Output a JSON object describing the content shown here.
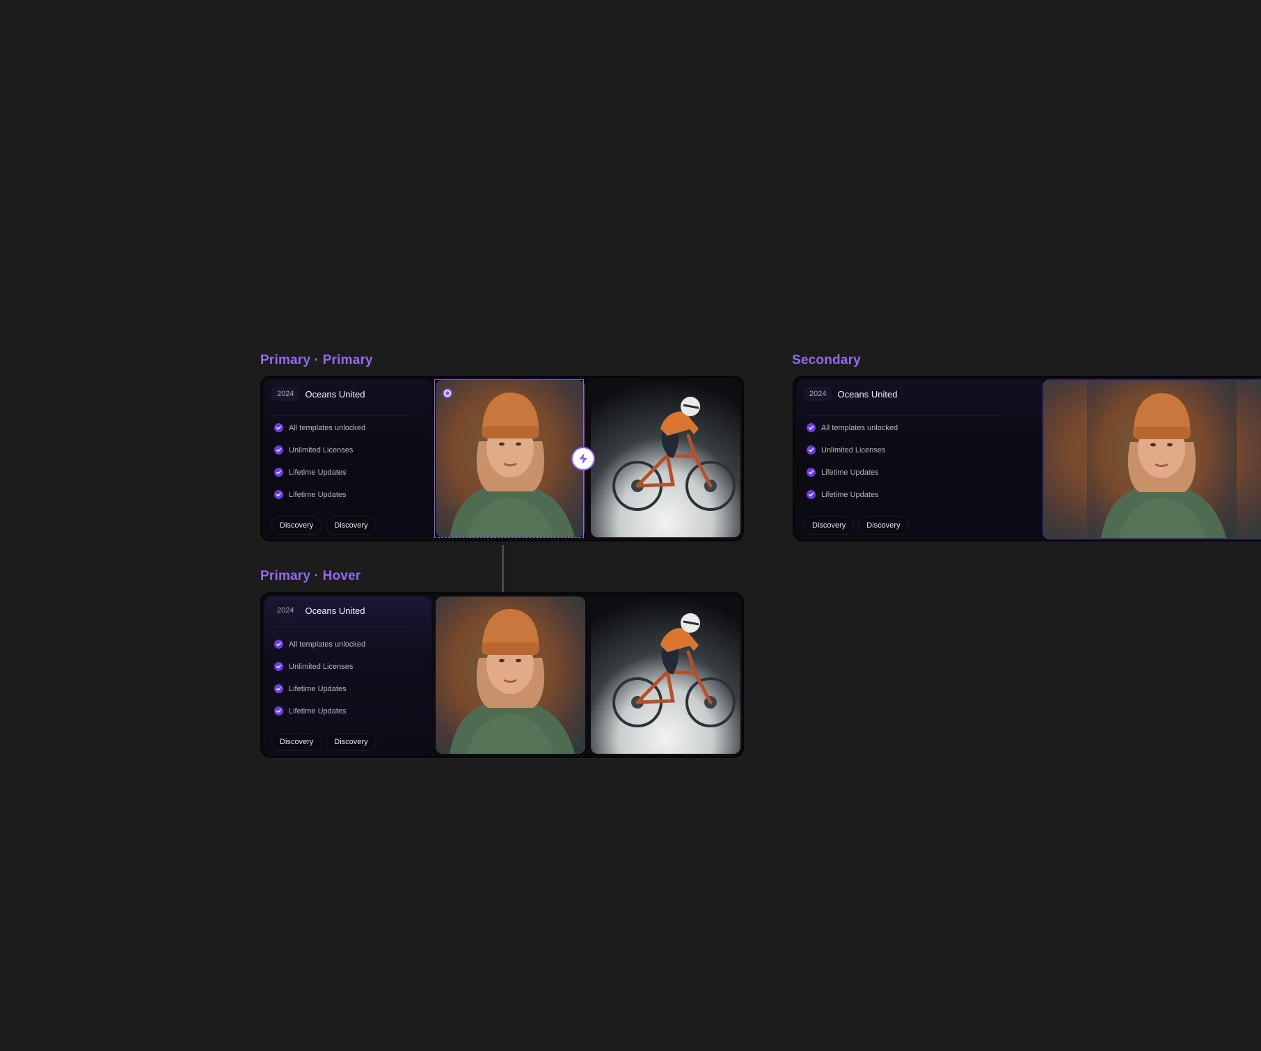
{
  "labels": {
    "primary_primary": "Primary · Primary",
    "primary_hover": "Primary · Hover",
    "secondary": "Secondary"
  },
  "card": {
    "year": "2024",
    "title": "Oceans United",
    "features": [
      "All templates unlocked",
      "Unlimited Licenses",
      "Lifetime Updates",
      "Lifetime Updates"
    ],
    "tags": [
      "Discovery",
      "Discovery"
    ]
  },
  "colors": {
    "background": "#1c1c1c",
    "accent": "#9469f2",
    "check": "#6c3ce6"
  },
  "icons": {
    "feature": "check-circle-icon",
    "selection": "radio-handle-icon",
    "action": "lightning-bolt-icon"
  },
  "images": [
    "woman-portrait-beanie",
    "mountain-biker"
  ]
}
